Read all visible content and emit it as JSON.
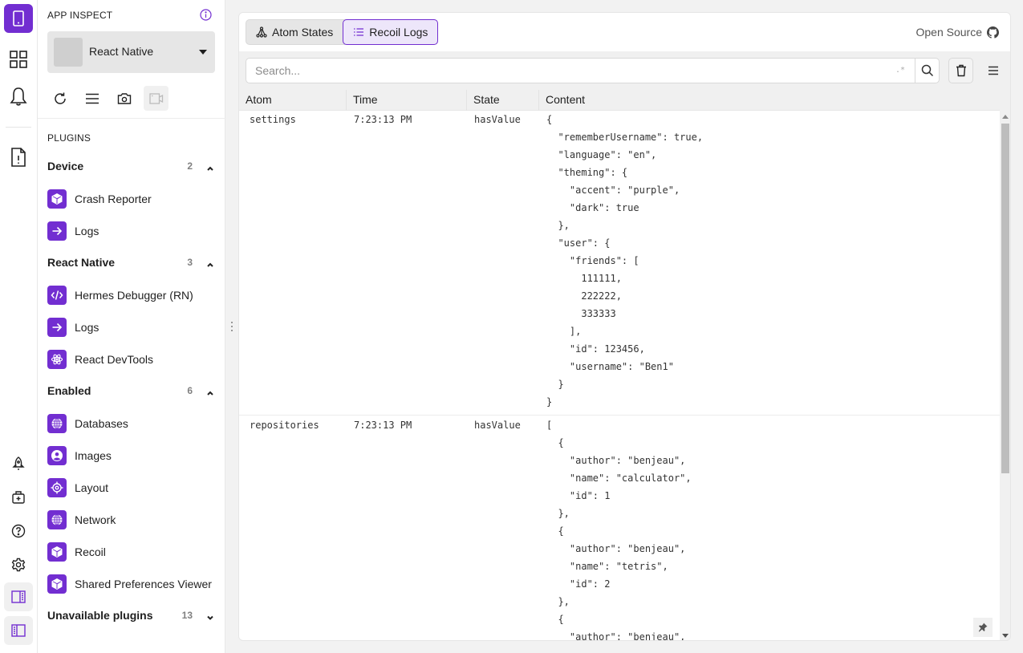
{
  "colors": {
    "accent": "#722ed1"
  },
  "rail": {
    "top_icons": [
      "device-icon",
      "apps-grid-icon",
      "bell-icon",
      "crash-report-icon"
    ],
    "bottom_icons": [
      "rocket-icon",
      "first-aid-kit-icon",
      "help-icon",
      "settings-icon",
      "right-panel-icon",
      "left-panel-icon"
    ]
  },
  "sidebar": {
    "title": "APP INSPECT",
    "device": {
      "name": "React Native"
    },
    "plugins_label": "PLUGINS",
    "groups": [
      {
        "title": "Device",
        "count": "2",
        "expanded": true,
        "items": [
          {
            "label": "Crash Reporter",
            "icon": "cube-icon"
          },
          {
            "label": "Logs",
            "icon": "arrow-right-icon"
          }
        ]
      },
      {
        "title": "React Native",
        "count": "3",
        "expanded": true,
        "items": [
          {
            "label": "Hermes Debugger (RN)",
            "icon": "code-icon"
          },
          {
            "label": "Logs",
            "icon": "arrow-right-icon"
          },
          {
            "label": "React DevTools",
            "icon": "atom-icon"
          }
        ]
      },
      {
        "title": "Enabled",
        "count": "6",
        "expanded": true,
        "items": [
          {
            "label": "Databases",
            "icon": "globe-icon"
          },
          {
            "label": "Images",
            "icon": "user-circle-icon"
          },
          {
            "label": "Layout",
            "icon": "target-icon"
          },
          {
            "label": "Network",
            "icon": "globe-icon"
          },
          {
            "label": "Recoil",
            "icon": "cube-icon"
          },
          {
            "label": "Shared Preferences Viewer",
            "icon": "cube-icon"
          }
        ]
      },
      {
        "title": "Unavailable plugins",
        "count": "13",
        "expanded": false,
        "items": []
      }
    ]
  },
  "main": {
    "tabs": [
      {
        "label": "Atom States",
        "active": false
      },
      {
        "label": "Recoil Logs",
        "active": true
      }
    ],
    "open_source_label": "Open Source",
    "search": {
      "placeholder": "Search...",
      "value": "",
      "regex_toggle": ".*"
    },
    "columns": [
      "Atom",
      "Time",
      "State",
      "Content"
    ],
    "rows": [
      {
        "atom": "settings",
        "time": "7:23:13 PM",
        "state": "hasValue",
        "content": [
          "{",
          "  \"rememberUsername\": true,",
          "  \"language\": \"en\",",
          "  \"theming\": {",
          "    \"accent\": \"purple\",",
          "    \"dark\": true",
          "  },",
          "  \"user\": {",
          "    \"friends\": [",
          "      111111,",
          "      222222,",
          "      333333",
          "    ],",
          "    \"id\": 123456,",
          "    \"username\": \"Ben1\"",
          "  }",
          "}"
        ]
      },
      {
        "atom": "repositories",
        "time": "7:23:13 PM",
        "state": "hasValue",
        "content": [
          "[",
          "  {",
          "    \"author\": \"benjeau\",",
          "    \"name\": \"calculator\",",
          "    \"id\": 1",
          "  },",
          "  {",
          "    \"author\": \"benjeau\",",
          "    \"name\": \"tetris\",",
          "    \"id\": 2",
          "  },",
          "  {",
          "    \"author\": \"benjeau\","
        ]
      }
    ]
  }
}
